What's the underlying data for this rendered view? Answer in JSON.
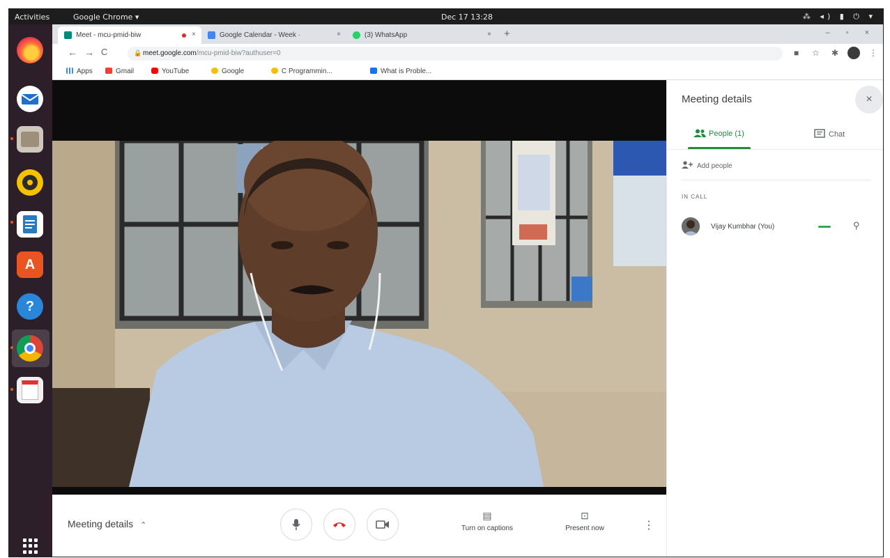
{
  "system_bar": {
    "activities": "Activities",
    "app_menu": "Google Chrome ▾",
    "clock": "Dec 17  13:28",
    "tray": "⁂ ◂) ▮ ⏻ ▾"
  },
  "dock": {
    "items": [
      "Firefox",
      "Thunderbird",
      "Files",
      "Rhythmbox",
      "LibreOffice Writer",
      "Ubuntu Software",
      "Help",
      "Google Chrome",
      "Document Scanner"
    ],
    "show_apps": "Show Applications"
  },
  "browser": {
    "tabs": [
      {
        "title": "Meet - mcu-pmid-biw",
        "close": "×"
      },
      {
        "title": "Google Calendar - Week ·",
        "close": "×"
      },
      {
        "title": "(3) WhatsApp",
        "close": "×"
      }
    ],
    "new_tab": "+",
    "window_controls": "– ▫ ×",
    "back": "←",
    "forward": "→",
    "reload": "C",
    "url_domain": "meet.google.com",
    "url_path": "/mcu-pmid-biw?authuser=0",
    "bookmarks": [
      "Apps",
      "Gmail",
      "YouTube",
      "Google",
      "C Programmin...",
      "What is Proble..."
    ]
  },
  "meet": {
    "bottom_bar": {
      "meeting_details": "Meeting details",
      "captions_label": "Turn on captions",
      "present_label": "Present now",
      "more": "⋮"
    },
    "side_panel": {
      "title": "Meeting details",
      "close": "×",
      "tab_people": "People (1)",
      "tab_chat": "Chat",
      "add_people": "Add people",
      "in_call_header": "IN CALL",
      "participants": [
        {
          "name": "Vijay Kumbhar (You)"
        }
      ]
    }
  },
  "colors": {
    "accent_green": "#1e8e3e",
    "end_call_red": "#d93025",
    "dock_bg": "#2c1f2a",
    "ubuntu_orange": "#e95420"
  }
}
